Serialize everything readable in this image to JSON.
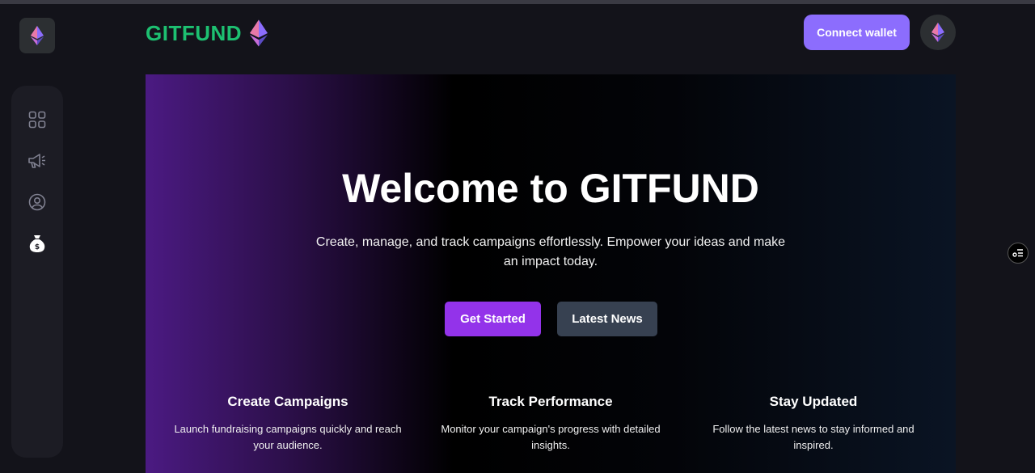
{
  "header": {
    "brand": "GITFUND",
    "connect_label": "Connect wallet"
  },
  "sidebar": {
    "items": [
      {
        "icon": "dashboard-grid-icon"
      },
      {
        "icon": "megaphone-icon"
      },
      {
        "icon": "profile-icon"
      },
      {
        "icon": "money-bag-icon"
      }
    ]
  },
  "hero": {
    "title": "Welcome to GITFUND",
    "subtitle": "Create, manage, and track campaigns effortlessly. Empower your ideas and make an impact today.",
    "primary_label": "Get Started",
    "secondary_label": "Latest News"
  },
  "features": [
    {
      "title": "Create Campaigns",
      "desc": "Launch fundraising campaigns quickly and reach your audience."
    },
    {
      "title": "Track Performance",
      "desc": "Monitor your campaign's progress with detailed insights."
    },
    {
      "title": "Stay Updated",
      "desc": "Follow the latest news to stay informed and inspired."
    }
  ],
  "colors": {
    "brand_green": "#1dc071",
    "accent_purple": "#8c6dfd",
    "primary_button": "#9333ea",
    "secondary_button": "#374151",
    "background": "#13131a",
    "sidebar": "#1c1c24"
  }
}
